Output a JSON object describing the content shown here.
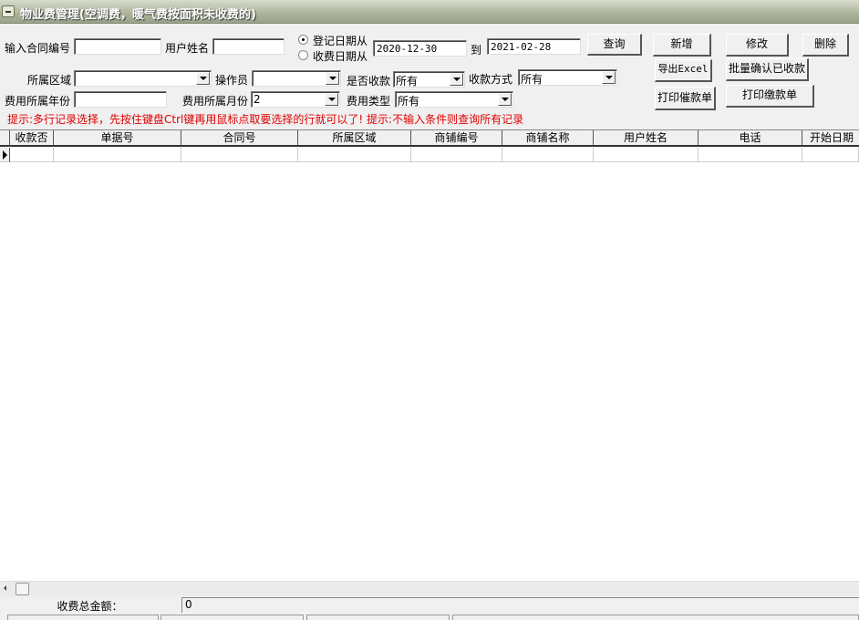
{
  "window": {
    "title": "物业费管理(空调费，暖气费按面积未收费的)"
  },
  "filters": {
    "contract_no_label": "输入合同编号",
    "contract_no_value": "",
    "user_name_label": "用户姓名",
    "user_name_value": "",
    "radio_register_date": "登记日期从",
    "radio_charge_date": "收费日期从",
    "date_from": "2020-12-30",
    "to_label": "到",
    "date_to": "2021-02-28",
    "area_label": "所属区域",
    "area_value": "",
    "operator_label": "操作员",
    "operator_value": "",
    "paid_label": "是否收款",
    "paid_value": "所有",
    "pay_method_label": "收款方式",
    "pay_method_value": "所有",
    "year_label": "费用所属年份",
    "year_value": "",
    "month_label": "费用所属月份",
    "month_value": "2",
    "fee_type_label": "费用类型",
    "fee_type_value": "所有"
  },
  "buttons": {
    "query": "查询",
    "add": "新增",
    "edit": "修改",
    "delete": "删除",
    "export": "导出Excel",
    "batch_confirm": "批量确认已收款",
    "print_reminder": "打印催款单",
    "print_payment": "打印缴款单"
  },
  "hint": "提示:多行记录选择，先按住键盘Ctrl键再用鼠标点取要选择的行就可以了! 提示:不输入条件则查询所有记录",
  "grid": {
    "columns": [
      "收款否",
      "单据号",
      "合同号",
      "所属区域",
      "商铺编号",
      "商铺名称",
      "用户姓名",
      "电话",
      "开始日期"
    ]
  },
  "summary": {
    "total_label": "收费总金额：",
    "total_value": "0"
  }
}
